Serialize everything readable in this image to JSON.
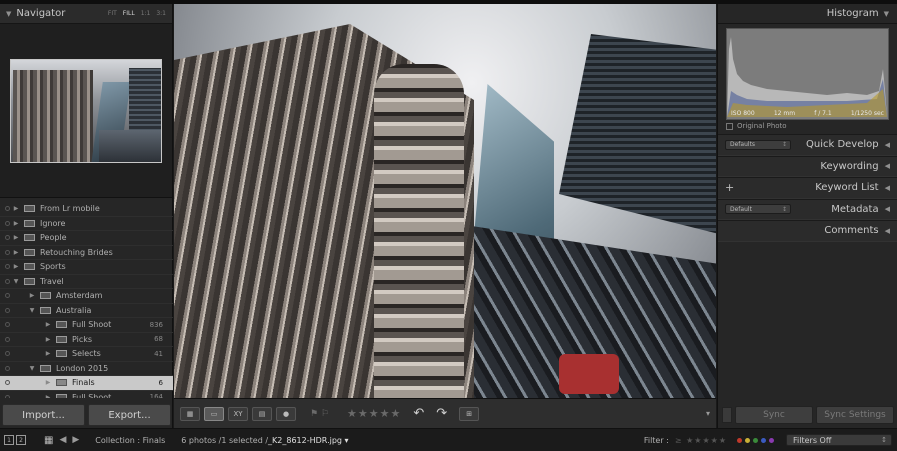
{
  "navigator": {
    "title": "Navigator",
    "zoom_options": [
      "FIT",
      "FILL",
      "1:1",
      "3:1"
    ],
    "active_zoom": "FILL"
  },
  "folders": [
    {
      "label": "From Lr mobile",
      "level": 1,
      "expanded": false,
      "count": ""
    },
    {
      "label": "Ignore",
      "level": 1,
      "expanded": false,
      "count": ""
    },
    {
      "label": "People",
      "level": 1,
      "expanded": false,
      "count": ""
    },
    {
      "label": "Retouching Brides",
      "level": 1,
      "expanded": false,
      "count": ""
    },
    {
      "label": "Sports",
      "level": 1,
      "expanded": false,
      "count": ""
    },
    {
      "label": "Travel",
      "level": 1,
      "expanded": true,
      "count": ""
    },
    {
      "label": "Amsterdam",
      "level": 2,
      "expanded": false,
      "count": ""
    },
    {
      "label": "Australia",
      "level": 2,
      "expanded": true,
      "count": ""
    },
    {
      "label": "Full Shoot",
      "level": 3,
      "expanded": false,
      "count": "836"
    },
    {
      "label": "Picks",
      "level": 3,
      "expanded": false,
      "count": "68"
    },
    {
      "label": "Selects",
      "level": 3,
      "expanded": false,
      "count": "41"
    },
    {
      "label": "London 2015",
      "level": 2,
      "expanded": true,
      "count": ""
    },
    {
      "label": "Finals",
      "level": 3,
      "expanded": false,
      "count": "6",
      "selected": true
    },
    {
      "label": "Full Shoot",
      "level": 3,
      "expanded": false,
      "count": "164"
    }
  ],
  "left_buttons": {
    "import": "Import...",
    "export": "Export..."
  },
  "toolbar": {
    "view_modes": [
      "grid-view",
      "loupe-view",
      "compare-view",
      "survey-view",
      "people-view"
    ],
    "compare_label": "XY",
    "stars": "★★★★★",
    "flags": "⚑ ⚐",
    "rotate_left": "↶",
    "rotate_right": "↷",
    "menu": "▾"
  },
  "histogram": {
    "title": "Histogram",
    "iso": "ISO 800",
    "focal": "12 mm",
    "aperture": "f / 7.1",
    "shutter": "1/1250 sec",
    "original_photo": "Original Photo"
  },
  "right_sections": [
    {
      "label": "Quick Develop",
      "selector": "Defaults",
      "plus": false
    },
    {
      "label": "Keywording",
      "selector": "",
      "plus": false
    },
    {
      "label": "Keyword List",
      "selector": "",
      "plus": true
    },
    {
      "label": "Metadata",
      "selector": "Default",
      "plus": false
    },
    {
      "label": "Comments",
      "selector": "",
      "plus": false
    }
  ],
  "right_buttons": {
    "sync": "Sync",
    "sync_settings": "Sync Settings"
  },
  "bottombar": {
    "screen1": "1",
    "screen2": "2",
    "collection": "Collection : Finals",
    "info": "6 photos /1 selected /",
    "filename": "_K2_8612-HDR.jpg",
    "filter_label": "Filter :",
    "filter_stars": "≥ ★★★★★",
    "filters_off": "Filters Off"
  },
  "colors": {
    "background": "#1a1a1a",
    "panel": "#262626",
    "selected_row": "#c9c9c9",
    "label_red": "#c0392b",
    "label_yellow": "#c9b037",
    "label_green": "#3a8a3a",
    "label_blue": "#3a5ac0",
    "label_purple": "#8a3ab0"
  }
}
